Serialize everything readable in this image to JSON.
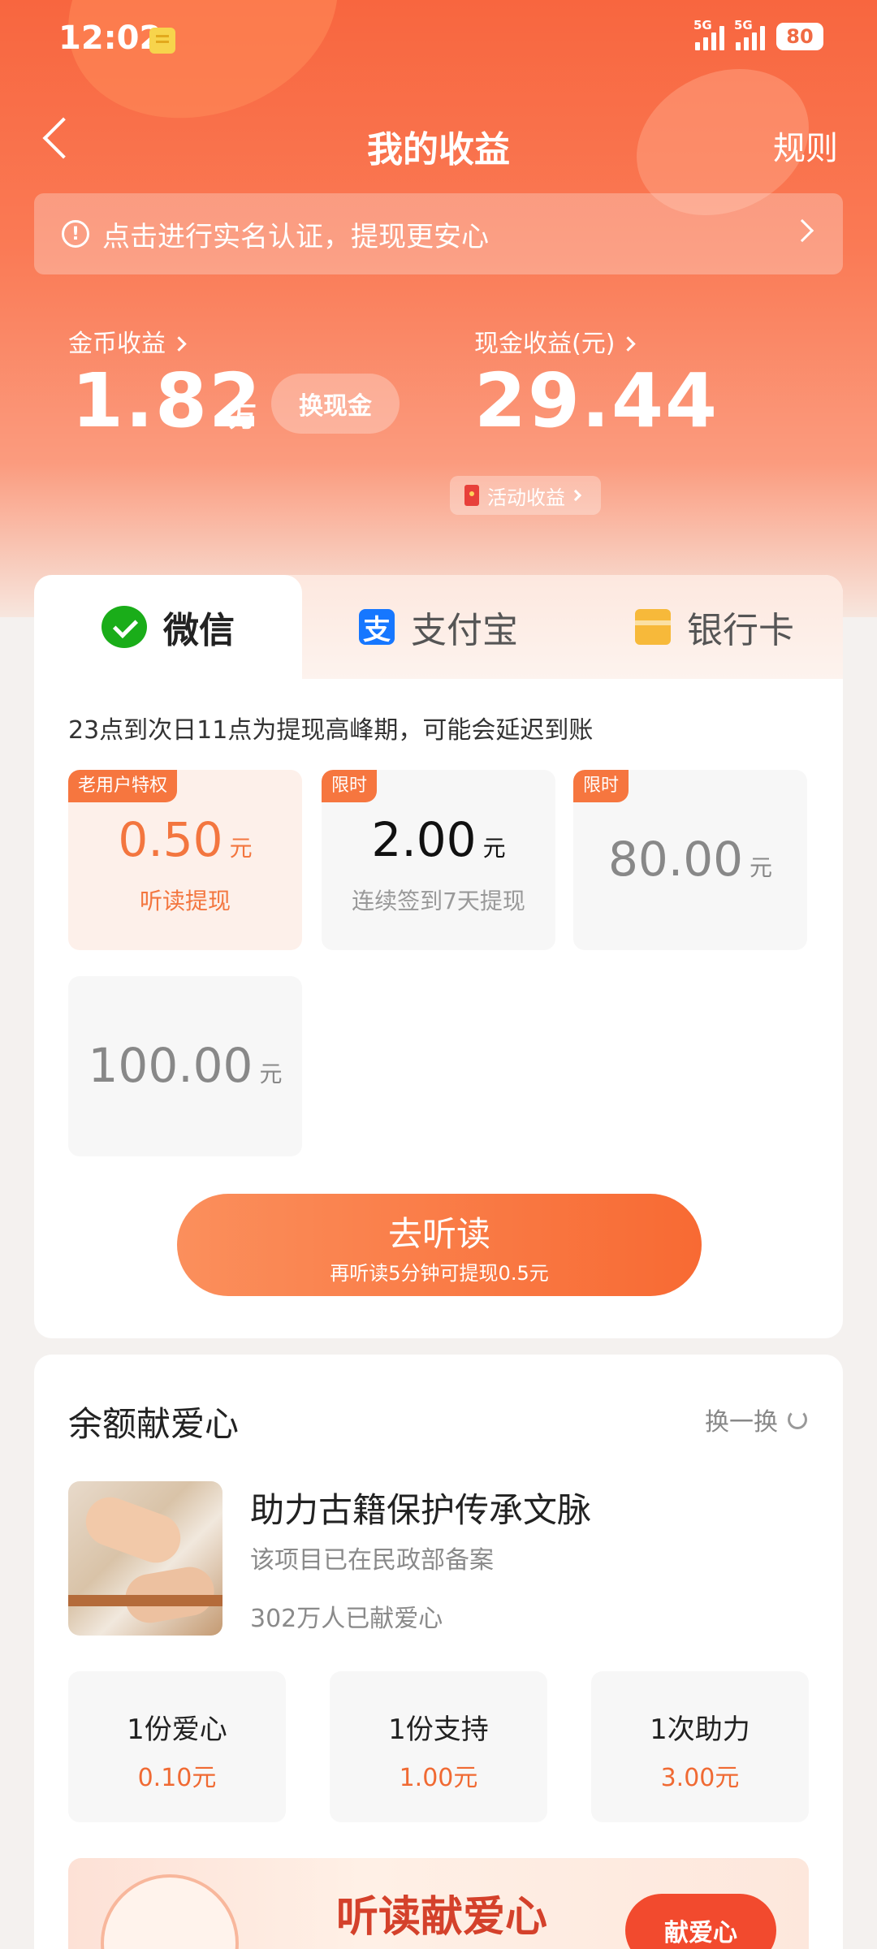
{
  "status_bar": {
    "time": "12:02",
    "signal1": "5G",
    "signal2": "5G",
    "battery": "80"
  },
  "nav": {
    "title": "我的收益",
    "rules": "规则"
  },
  "notice": {
    "icon": "!",
    "text": "点击进行实名认证，提现更安心"
  },
  "earnings": {
    "coin_label": "金币收益",
    "coin_value": "1.82",
    "coin_unit": "万",
    "exchange_button": "换现金",
    "cash_label": "现金收益(元)",
    "cash_value": "29.44",
    "activity": "活动收益"
  },
  "tabs": [
    {
      "label": "微信",
      "icon": "wechat-icon"
    },
    {
      "label": "支付宝",
      "icon": "alipay-icon",
      "glyph": "支"
    },
    {
      "label": "银行卡",
      "icon": "bank-card-icon"
    }
  ],
  "withdraw": {
    "peak_notice": "23点到次日11点为提现高峰期，可能会延迟到账",
    "options": [
      {
        "badge": "老用户特权",
        "amount": "0.50",
        "unit": "元",
        "desc": "听读提现",
        "selected": true
      },
      {
        "badge": "限时",
        "amount": "2.00",
        "unit": "元",
        "desc": "连续签到7天提现"
      },
      {
        "badge": "限时",
        "amount": "80.00",
        "unit": "元"
      },
      {
        "amount": "100.00",
        "unit": "元"
      }
    ],
    "cta_main": "去听读",
    "cta_sub": "再听读5分钟可提现0.5元"
  },
  "donation": {
    "title": "余额献爱心",
    "refresh": "换一换",
    "project_title": "助力古籍保护传承文脉",
    "project_sub": "该项目已在民政部备案",
    "project_count": "302万人已献爱心",
    "options": [
      {
        "name": "1份爱心",
        "price": "0.10元"
      },
      {
        "name": "1份支持",
        "price": "1.00元"
      },
      {
        "name": "1次助力",
        "price": "3.00元"
      }
    ],
    "banner_title": "听读献爱心",
    "banner_button": "献爱心"
  },
  "colors": {
    "accent": "#f86a33",
    "hero_top": "#f8663f",
    "wechat": "#1aad19",
    "alipay": "#1677ff"
  }
}
